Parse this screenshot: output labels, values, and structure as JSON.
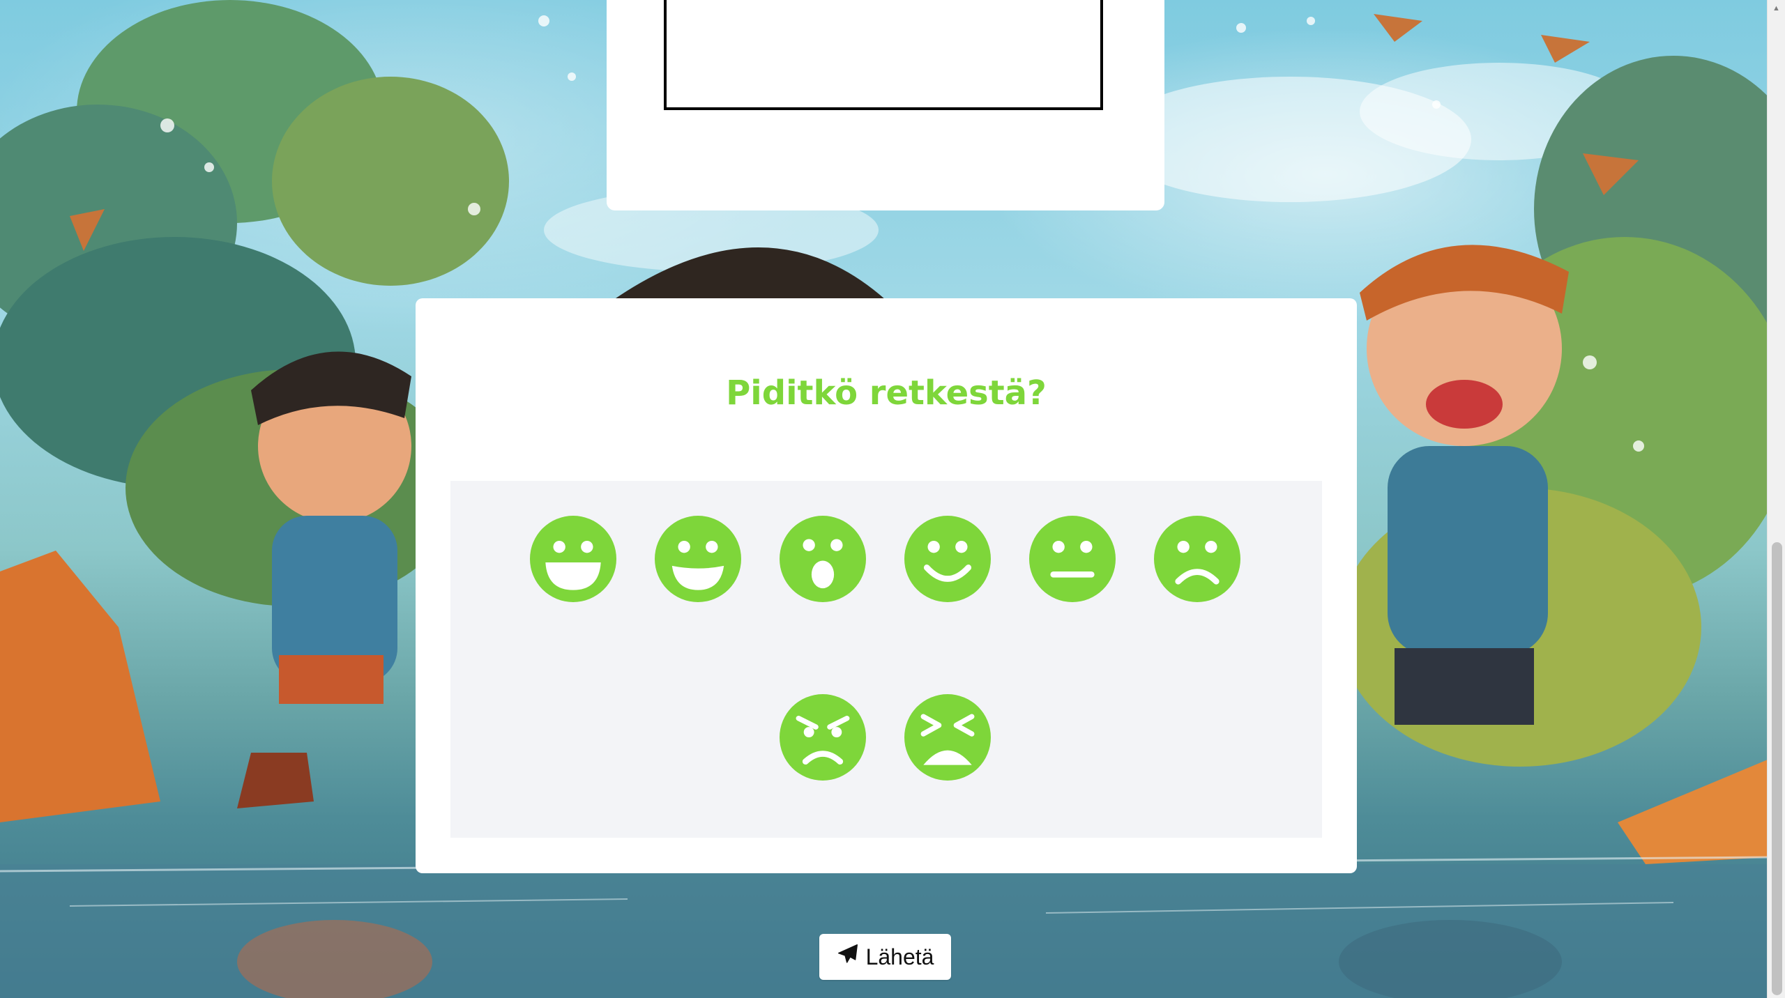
{
  "question": {
    "title": "Piditkö retkestä?",
    "accent_color": "#7ed63a",
    "faces": [
      {
        "name": "grin-big-icon"
      },
      {
        "name": "grin-icon"
      },
      {
        "name": "surprised-icon"
      },
      {
        "name": "smile-icon"
      },
      {
        "name": "neutral-icon"
      },
      {
        "name": "frown-icon"
      },
      {
        "name": "angry-icon"
      },
      {
        "name": "tired-icon"
      }
    ]
  },
  "send_button": {
    "label": "Lähetä",
    "icon": "paper-plane-icon"
  }
}
